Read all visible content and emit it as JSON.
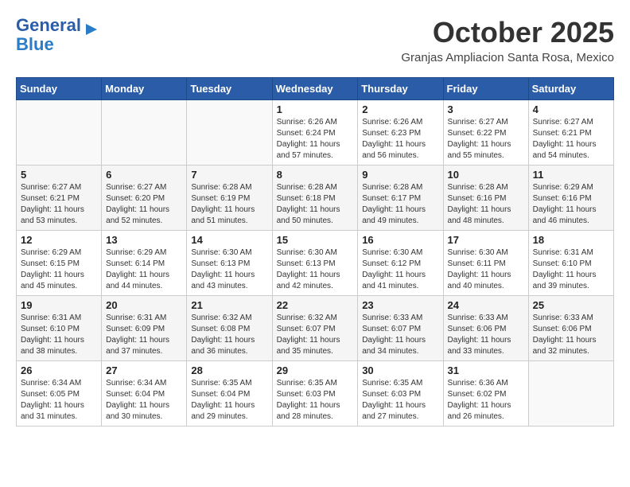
{
  "header": {
    "logo_general": "General",
    "logo_blue": "Blue",
    "month": "October 2025",
    "location": "Granjas Ampliacion Santa Rosa, Mexico"
  },
  "weekdays": [
    "Sunday",
    "Monday",
    "Tuesday",
    "Wednesday",
    "Thursday",
    "Friday",
    "Saturday"
  ],
  "weeks": [
    [
      {
        "day": "",
        "info": ""
      },
      {
        "day": "",
        "info": ""
      },
      {
        "day": "",
        "info": ""
      },
      {
        "day": "1",
        "info": "Sunrise: 6:26 AM\nSunset: 6:24 PM\nDaylight: 11 hours and 57 minutes."
      },
      {
        "day": "2",
        "info": "Sunrise: 6:26 AM\nSunset: 6:23 PM\nDaylight: 11 hours and 56 minutes."
      },
      {
        "day": "3",
        "info": "Sunrise: 6:27 AM\nSunset: 6:22 PM\nDaylight: 11 hours and 55 minutes."
      },
      {
        "day": "4",
        "info": "Sunrise: 6:27 AM\nSunset: 6:21 PM\nDaylight: 11 hours and 54 minutes."
      }
    ],
    [
      {
        "day": "5",
        "info": "Sunrise: 6:27 AM\nSunset: 6:21 PM\nDaylight: 11 hours and 53 minutes."
      },
      {
        "day": "6",
        "info": "Sunrise: 6:27 AM\nSunset: 6:20 PM\nDaylight: 11 hours and 52 minutes."
      },
      {
        "day": "7",
        "info": "Sunrise: 6:28 AM\nSunset: 6:19 PM\nDaylight: 11 hours and 51 minutes."
      },
      {
        "day": "8",
        "info": "Sunrise: 6:28 AM\nSunset: 6:18 PM\nDaylight: 11 hours and 50 minutes."
      },
      {
        "day": "9",
        "info": "Sunrise: 6:28 AM\nSunset: 6:17 PM\nDaylight: 11 hours and 49 minutes."
      },
      {
        "day": "10",
        "info": "Sunrise: 6:28 AM\nSunset: 6:16 PM\nDaylight: 11 hours and 48 minutes."
      },
      {
        "day": "11",
        "info": "Sunrise: 6:29 AM\nSunset: 6:16 PM\nDaylight: 11 hours and 46 minutes."
      }
    ],
    [
      {
        "day": "12",
        "info": "Sunrise: 6:29 AM\nSunset: 6:15 PM\nDaylight: 11 hours and 45 minutes."
      },
      {
        "day": "13",
        "info": "Sunrise: 6:29 AM\nSunset: 6:14 PM\nDaylight: 11 hours and 44 minutes."
      },
      {
        "day": "14",
        "info": "Sunrise: 6:30 AM\nSunset: 6:13 PM\nDaylight: 11 hours and 43 minutes."
      },
      {
        "day": "15",
        "info": "Sunrise: 6:30 AM\nSunset: 6:13 PM\nDaylight: 11 hours and 42 minutes."
      },
      {
        "day": "16",
        "info": "Sunrise: 6:30 AM\nSunset: 6:12 PM\nDaylight: 11 hours and 41 minutes."
      },
      {
        "day": "17",
        "info": "Sunrise: 6:30 AM\nSunset: 6:11 PM\nDaylight: 11 hours and 40 minutes."
      },
      {
        "day": "18",
        "info": "Sunrise: 6:31 AM\nSunset: 6:10 PM\nDaylight: 11 hours and 39 minutes."
      }
    ],
    [
      {
        "day": "19",
        "info": "Sunrise: 6:31 AM\nSunset: 6:10 PM\nDaylight: 11 hours and 38 minutes."
      },
      {
        "day": "20",
        "info": "Sunrise: 6:31 AM\nSunset: 6:09 PM\nDaylight: 11 hours and 37 minutes."
      },
      {
        "day": "21",
        "info": "Sunrise: 6:32 AM\nSunset: 6:08 PM\nDaylight: 11 hours and 36 minutes."
      },
      {
        "day": "22",
        "info": "Sunrise: 6:32 AM\nSunset: 6:07 PM\nDaylight: 11 hours and 35 minutes."
      },
      {
        "day": "23",
        "info": "Sunrise: 6:33 AM\nSunset: 6:07 PM\nDaylight: 11 hours and 34 minutes."
      },
      {
        "day": "24",
        "info": "Sunrise: 6:33 AM\nSunset: 6:06 PM\nDaylight: 11 hours and 33 minutes."
      },
      {
        "day": "25",
        "info": "Sunrise: 6:33 AM\nSunset: 6:06 PM\nDaylight: 11 hours and 32 minutes."
      }
    ],
    [
      {
        "day": "26",
        "info": "Sunrise: 6:34 AM\nSunset: 6:05 PM\nDaylight: 11 hours and 31 minutes."
      },
      {
        "day": "27",
        "info": "Sunrise: 6:34 AM\nSunset: 6:04 PM\nDaylight: 11 hours and 30 minutes."
      },
      {
        "day": "28",
        "info": "Sunrise: 6:35 AM\nSunset: 6:04 PM\nDaylight: 11 hours and 29 minutes."
      },
      {
        "day": "29",
        "info": "Sunrise: 6:35 AM\nSunset: 6:03 PM\nDaylight: 11 hours and 28 minutes."
      },
      {
        "day": "30",
        "info": "Sunrise: 6:35 AM\nSunset: 6:03 PM\nDaylight: 11 hours and 27 minutes."
      },
      {
        "day": "31",
        "info": "Sunrise: 6:36 AM\nSunset: 6:02 PM\nDaylight: 11 hours and 26 minutes."
      },
      {
        "day": "",
        "info": ""
      }
    ]
  ]
}
